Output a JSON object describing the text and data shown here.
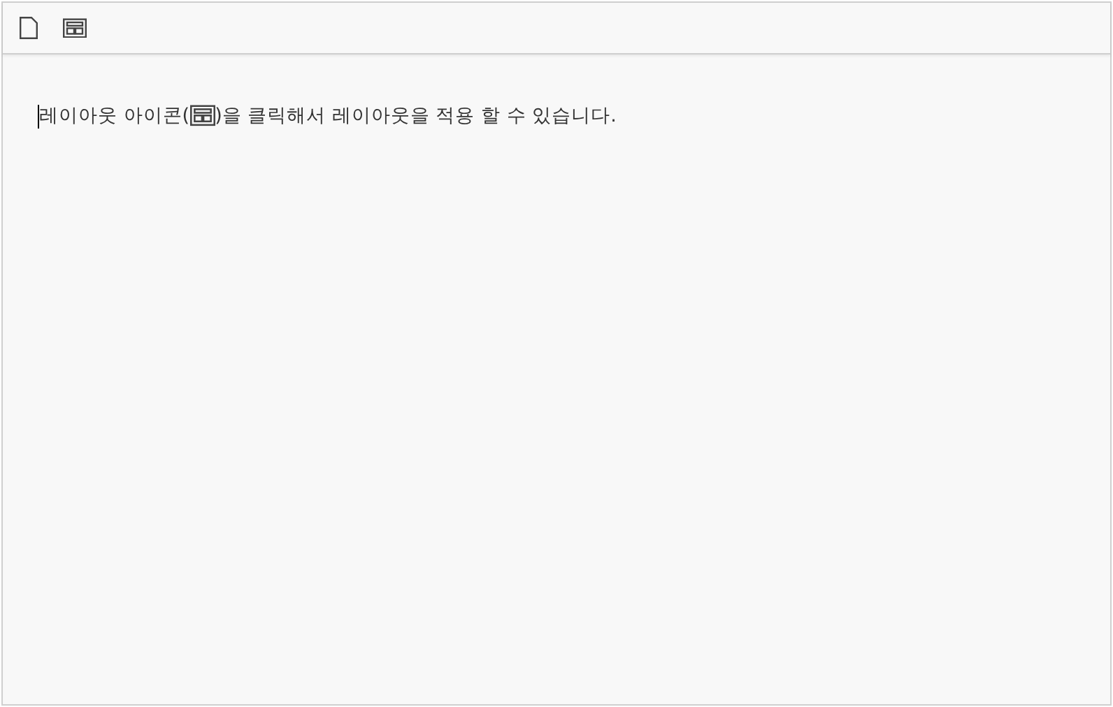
{
  "editor": {
    "text_before_icon": "레이아웃 아이콘(",
    "text_after_icon": ")을 클릭해서 레이아웃을 적용 할 수 있습니다."
  }
}
